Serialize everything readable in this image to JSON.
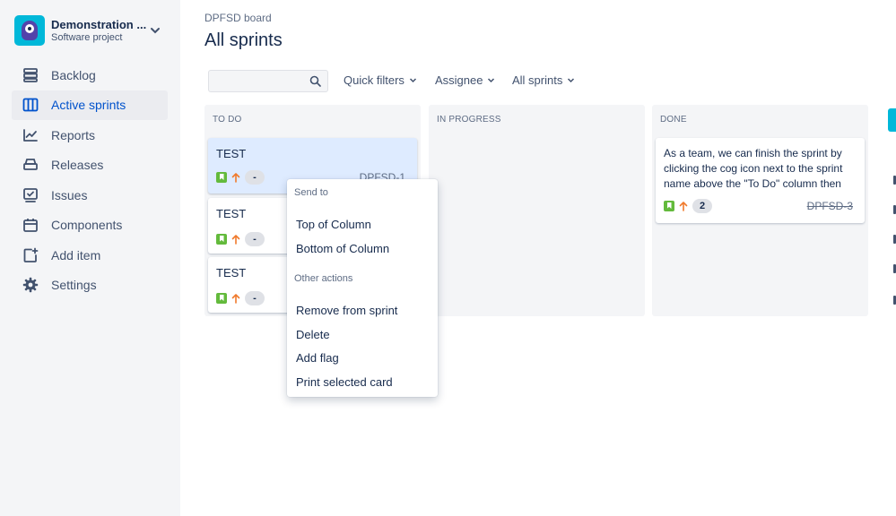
{
  "project": {
    "name": "Demonstration ...",
    "type": "Software project"
  },
  "nav": [
    {
      "label": "Backlog",
      "icon": "backlog-icon"
    },
    {
      "label": "Active sprints",
      "icon": "board-icon",
      "active": true
    },
    {
      "label": "Reports",
      "icon": "reports-icon"
    },
    {
      "label": "Releases",
      "icon": "releases-icon"
    },
    {
      "label": "Issues",
      "icon": "issues-icon"
    },
    {
      "label": "Components",
      "icon": "components-icon"
    },
    {
      "label": "Add item",
      "icon": "add-item-icon"
    },
    {
      "label": "Settings",
      "icon": "gear-icon"
    }
  ],
  "breadcrumb": "DPFSD board",
  "title": "All sprints",
  "search": {
    "placeholder": ""
  },
  "filters": {
    "quick": "Quick filters",
    "assignee": "Assignee",
    "sprints": "All sprints"
  },
  "columns": [
    {
      "header": "TO DO"
    },
    {
      "header": "IN PROGRESS"
    },
    {
      "header": "DONE"
    }
  ],
  "cards": {
    "todo": [
      {
        "title": "TEST",
        "estimate": "-",
        "key": "DPFSD-1"
      },
      {
        "title": "TEST",
        "estimate": "-"
      },
      {
        "title": "TEST",
        "estimate": "-"
      }
    ],
    "done": [
      {
        "title": "As a team, we can finish the sprint by clicking the cog icon next to the sprint name above the \"To Do\" column then",
        "estimate": "2",
        "key": "DPFSD-3"
      }
    ]
  },
  "menu": {
    "send_to": "Send to",
    "top": "Top of Column",
    "bottom": "Bottom of Column",
    "other": "Other actions",
    "remove": "Remove from sprint",
    "delete": "Delete",
    "flag": "Add flag",
    "print": "Print selected card"
  },
  "colors": {
    "accent": "#0052CC",
    "story": "#63BA3C",
    "priority": "#F07A2C",
    "sidebar": "#F4F5F7"
  }
}
